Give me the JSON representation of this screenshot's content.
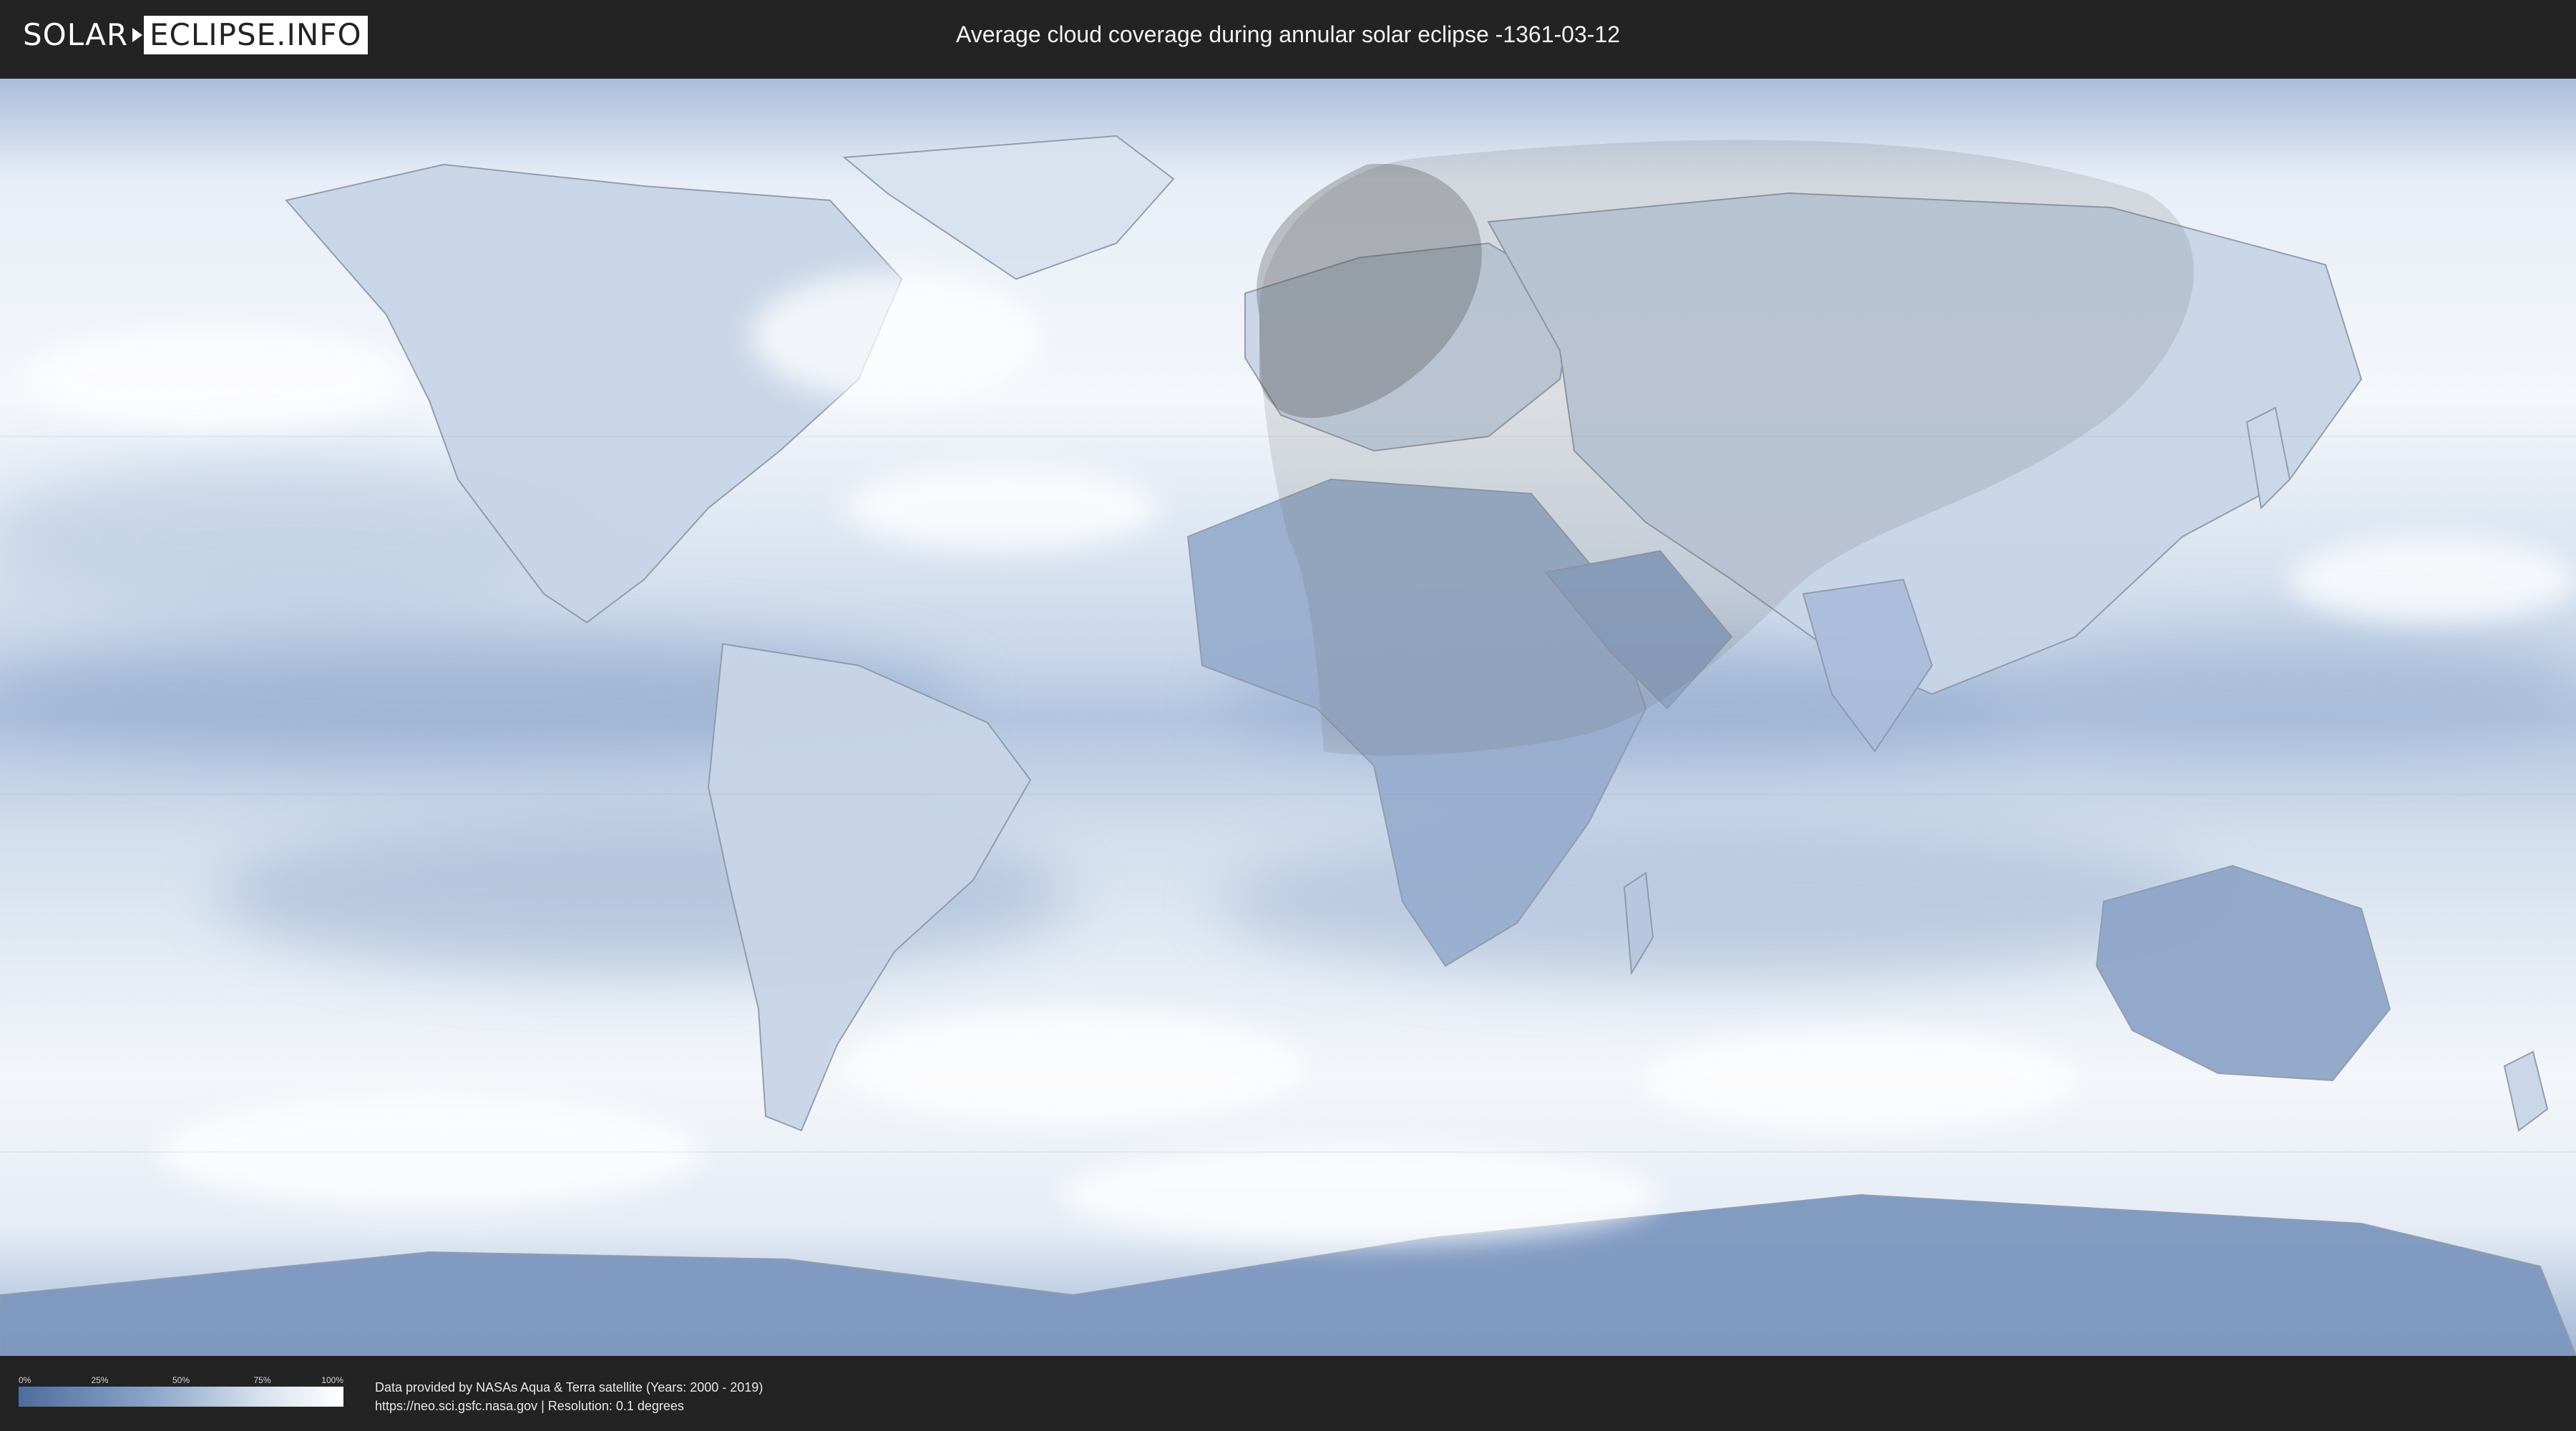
{
  "header": {
    "logo_left": "SOLAR",
    "logo_right": "ECLIPSE.INFO",
    "title": "Average cloud coverage during annular solar eclipse -1361-03-12"
  },
  "map": {
    "projection": "equirectangular",
    "colors": {
      "ocean_clear": "#5b7aa8",
      "cloud": "#ffffff",
      "eclipse_overlay": "#6e6e6e",
      "border_lines": "#8a94a3"
    }
  },
  "legend": {
    "ticks": [
      "0%",
      "25%",
      "50%",
      "75%",
      "100%"
    ],
    "gradient_start": "#4f6d9c",
    "gradient_end": "#ffffff"
  },
  "credits": {
    "line1": "Data provided by NASAs Aqua & Terra satellite (Years: 2000 - 2019)",
    "line2": "https://neo.sci.gsfc.nasa.gov | Resolution: 0.1 degrees"
  }
}
